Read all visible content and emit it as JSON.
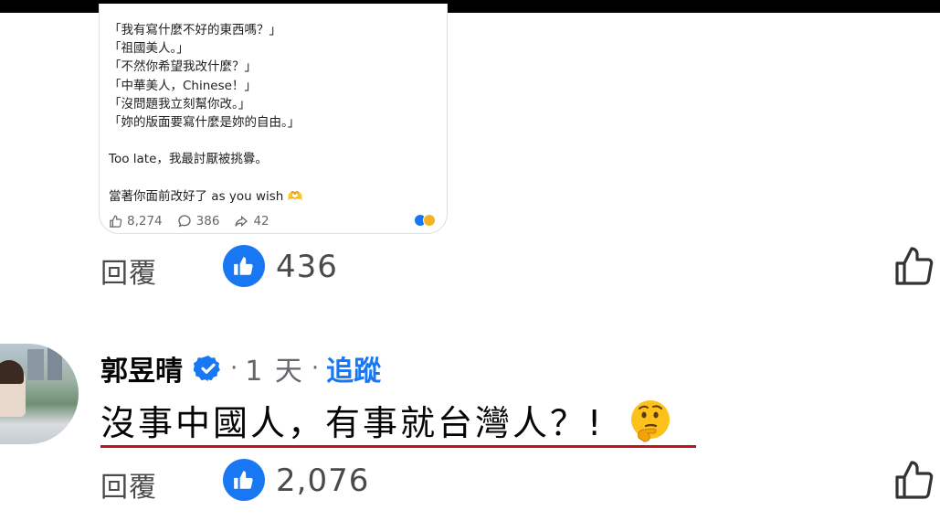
{
  "post_card": {
    "lines": [
      "「我有寫什麼不好的東西嗎？」",
      "「祖國美人。」",
      "「不然你希望我改什麼？」",
      "「中華美人，Chinese！」",
      "「沒問題我立刻幫你改。」",
      "「妳的版面要寫什麼是妳的自由。」",
      "",
      "Too late，我最討厭被挑釁。",
      "",
      "當著你面前改好了 as you wish 🫶"
    ],
    "likes": "8,274",
    "comments": "386",
    "shares": "42"
  },
  "reply_row_1": {
    "reply_label": "回覆",
    "like_count": "436"
  },
  "comment": {
    "author": "郭昱晴",
    "separator": "·",
    "time": "1 天",
    "follow_label": "追蹤",
    "text": "沒事中國人，有事就台灣人？!",
    "emoji": "thinking-face"
  },
  "reply_row_2": {
    "reply_label": "回覆",
    "like_count": "2,076"
  },
  "colors": {
    "accent": "#1877f2",
    "underline": "#c1121f",
    "muted": "#65676b"
  }
}
